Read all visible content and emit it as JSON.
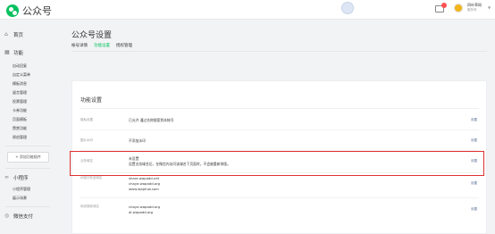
{
  "topbar": {
    "brand": "公众号",
    "account_name": "四叶草网",
    "account_sub": "服务号",
    "mail_badge": "6"
  },
  "sidebar": {
    "home": "首页",
    "features": "功能",
    "feature_items": [
      "自动回复",
      "自定义菜单",
      "模板消息",
      "留言管理",
      "投票管理",
      "卡券功能",
      "页面模板",
      "赞赏功能",
      "原创管理"
    ],
    "add_plugin": "+ 添加功能插件",
    "miniprogram": "小程序",
    "mini_items": [
      "小程序管理",
      "展示场景"
    ],
    "wechat_pay": "微信支付"
  },
  "main": {
    "title": "公众号设置",
    "tabs": [
      "帐号详情",
      "功能设置",
      "授权管理"
    ],
    "active_tab": "功能设置",
    "card_title": "功能设置",
    "rows": [
      {
        "label": "隐私设置",
        "lines": [
          "已允许 通过名称搜索到本帐号"
        ],
        "action": "设置"
      },
      {
        "label": "图片水印",
        "lines": [
          "不添加水印"
        ],
        "action": "设置"
      },
      {
        "label": "业务域名",
        "lines": [
          "未设置",
          "设置业务域名后，在微信内访问该域名下页面时，不会被重新排版。"
        ],
        "action": "设置"
      },
      {
        "label": "JS接口安全域名",
        "lines": [
          "share.wapadd.net",
          "chaye.wapadd.org",
          "www.wapfuw.com"
        ],
        "action": "设置"
      },
      {
        "label": "网页授权域名",
        "lines": [
          "chaye.wapadd.org",
          "dl.wapadd.org"
        ],
        "action": "设置"
      }
    ]
  },
  "colors": {
    "accent": "#07c160",
    "highlight": "#e03131",
    "link": "#576b95"
  }
}
